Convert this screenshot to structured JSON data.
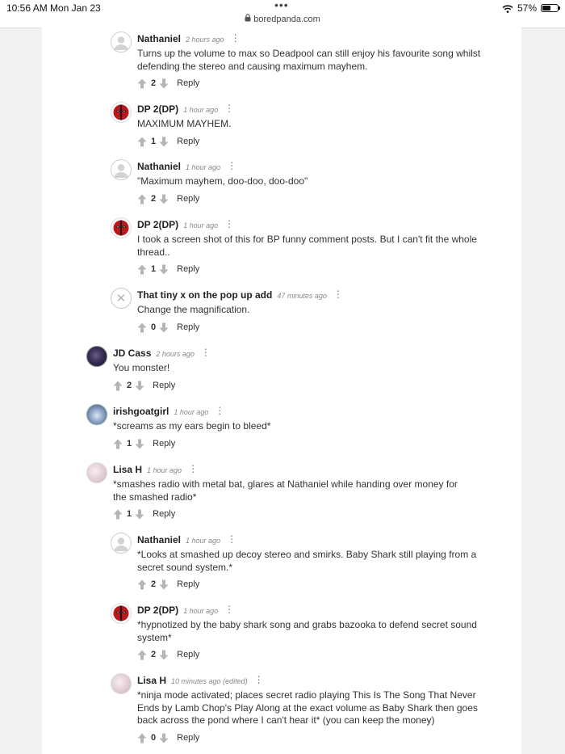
{
  "status_bar": {
    "time": "10:56 AM",
    "date": "Mon Jan 23",
    "url": "boredpanda.com",
    "battery_percent": "57%",
    "battery_level": 0.57
  },
  "comments": [
    {
      "author": "Nathaniel",
      "time": "2 hours ago",
      "text": "Turns up the volume to max so Deadpool can still enjoy his favourite song whilst defending the stereo and causing maximum mayhem.",
      "votes": "2",
      "reply": "Reply",
      "avatar": "generic"
    },
    {
      "author": "DP 2(DP)",
      "time": "1 hour ago",
      "text": "MAXIMUM MAYHEM.",
      "votes": "1",
      "reply": "Reply",
      "avatar": "deadpool"
    },
    {
      "author": "Nathaniel",
      "time": "1 hour ago",
      "text": "\"Maximum mayhem, doo-doo, doo-doo\"",
      "votes": "2",
      "reply": "Reply",
      "avatar": "generic"
    },
    {
      "author": "DP 2(DP)",
      "time": "1 hour ago",
      "text": "I took a screen shot of this for BP funny comment posts. But I can't fit the whole thread..",
      "votes": "1",
      "reply": "Reply",
      "avatar": "deadpool"
    },
    {
      "author": "That tiny x on the pop up add",
      "time": "47 minutes ago",
      "text": "Change the magnification.",
      "votes": "0",
      "reply": "Reply",
      "avatar": "x"
    },
    {
      "author": "JD Cass",
      "time": "2 hours ago",
      "text": "You monster!",
      "votes": "2",
      "reply": "Reply",
      "avatar": "jd"
    },
    {
      "author": "irishgoatgirl",
      "time": "1 hour ago",
      "text": "*screams as my ears begin to bleed*",
      "votes": "1",
      "reply": "Reply",
      "avatar": "irish"
    },
    {
      "author": "Lisa H",
      "time": "1 hour ago",
      "text": "*smashes radio with metal bat, glares at Nathaniel while handing over money for the smashed radio*",
      "votes": "1",
      "reply": "Reply",
      "avatar": "lisa"
    },
    {
      "author": "Nathaniel",
      "time": "1 hour ago",
      "text": "*Looks at smashed up decoy stereo and smirks. Baby Shark still playing from a secret sound system.*",
      "votes": "2",
      "reply": "Reply",
      "avatar": "generic"
    },
    {
      "author": "DP 2(DP)",
      "time": "1 hour ago",
      "text": "*hypnotized by the baby shark song and grabs bazooka to defend secret sound system*",
      "votes": "2",
      "reply": "Reply",
      "avatar": "deadpool"
    },
    {
      "author": "Lisa H",
      "time": "10 minutes ago (edited)",
      "text": "*ninja mode activated; places secret radio playing This Is The Song That Never Ends by Lamb Chop's Play Along at the exact volume as Baby Shark then goes back across the pond where I can't hear it* (you can keep the money)",
      "votes": "0",
      "reply": "Reply",
      "avatar": "lisa"
    }
  ]
}
